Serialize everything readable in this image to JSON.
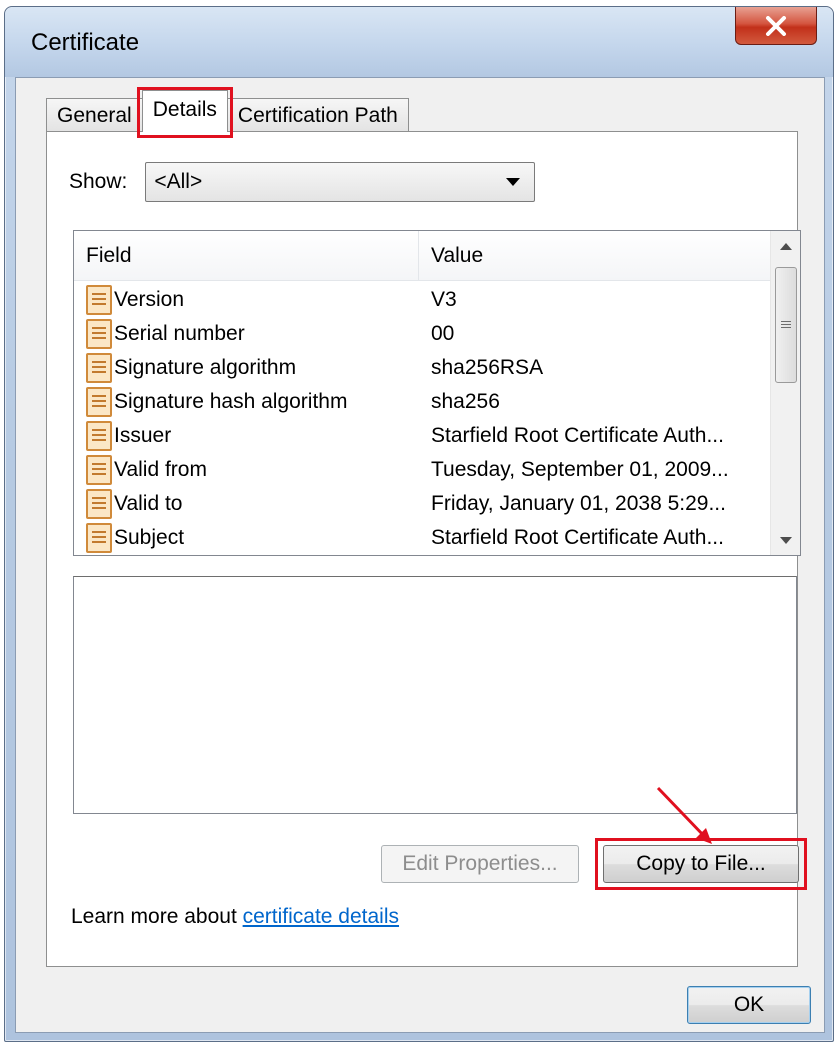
{
  "window": {
    "title": "Certificate",
    "close_label": "X"
  },
  "tabs": [
    {
      "label": "General",
      "active": false
    },
    {
      "label": "Details",
      "active": true
    },
    {
      "label": "Certification Path",
      "active": false
    }
  ],
  "show": {
    "label": "Show:",
    "selected": "<All>"
  },
  "list": {
    "columns": {
      "field": "Field",
      "value": "Value"
    },
    "rows": [
      {
        "field": "Version",
        "value": "V3"
      },
      {
        "field": "Serial number",
        "value": "00"
      },
      {
        "field": "Signature algorithm",
        "value": "sha256RSA"
      },
      {
        "field": "Signature hash algorithm",
        "value": "sha256"
      },
      {
        "field": "Issuer",
        "value": "Starfield Root Certificate Auth..."
      },
      {
        "field": "Valid from",
        "value": "Tuesday, September 01, 2009..."
      },
      {
        "field": "Valid to",
        "value": "Friday, January 01, 2038 5:29..."
      },
      {
        "field": "Subject",
        "value": "Starfield Root Certificate Auth..."
      }
    ]
  },
  "buttons": {
    "edit_properties": "Edit Properties...",
    "copy_to_file": "Copy to File...",
    "ok": "OK"
  },
  "learn_more": {
    "prefix": "Learn more about ",
    "link": "certificate details"
  },
  "colors": {
    "highlight": "#e0101f",
    "link": "#0066cc",
    "close": "#c2301a"
  }
}
